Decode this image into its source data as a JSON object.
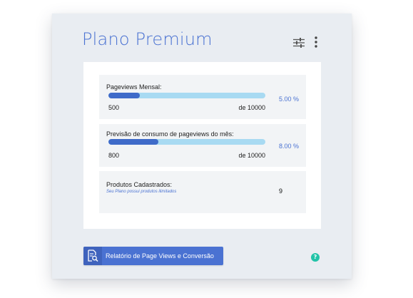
{
  "plan": {
    "title": "Plano Premium"
  },
  "header_icons": {
    "filter": "sliders-icon",
    "more": "more-vertical-icon"
  },
  "metrics": {
    "pageviews": {
      "label": "Pageviews Mensal:",
      "used": "500",
      "limit": "de 10000",
      "percent": "5.00 %",
      "progress_fraction": 0.05
    },
    "forecast": {
      "label": "Previsão de consumo de pageviews do mês:",
      "used": "800",
      "limit": "de 10000",
      "percent": "8.00 %",
      "progress_fraction": 0.08
    },
    "products": {
      "label": "Produtos Cadastrados:",
      "note": "Seu Plano possui produtos ilimitados",
      "count": "9"
    }
  },
  "actions": {
    "report_label": "Relatório de Page Views e Conversão",
    "report_icon": "document-search-icon",
    "help_label": "?"
  },
  "colors": {
    "accent": "#4a72d2",
    "bar_track": "#a8daf2",
    "bar_fill": "#3f6bc9",
    "help": "#22c3a8",
    "card_bg": "#e9edf2"
  }
}
